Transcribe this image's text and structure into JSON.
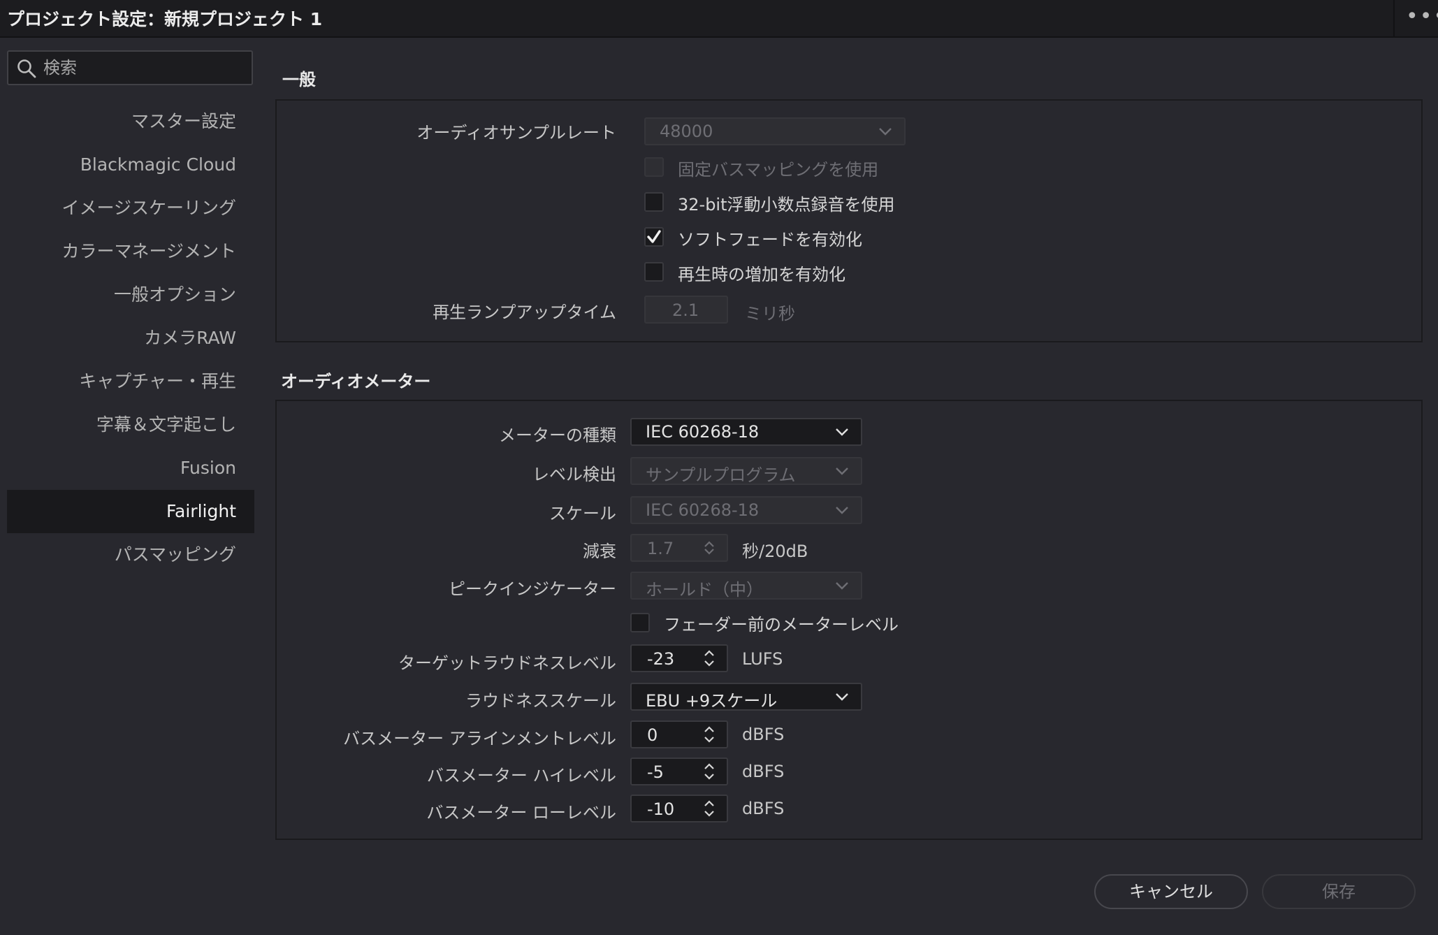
{
  "window": {
    "title": "プロジェクト設定：新規プロジェクト 1",
    "more": "•••"
  },
  "search": {
    "placeholder": "検索"
  },
  "sidebar": {
    "items": [
      {
        "label": "マスター設定"
      },
      {
        "label": "Blackmagic Cloud"
      },
      {
        "label": "イメージスケーリング"
      },
      {
        "label": "カラーマネージメント"
      },
      {
        "label": "一般オプション"
      },
      {
        "label": "カメラRAW"
      },
      {
        "label": "キャプチャー・再生"
      },
      {
        "label": "字幕＆文字起こし"
      },
      {
        "label": "Fusion"
      },
      {
        "label": "Fairlight"
      },
      {
        "label": "パスマッピング"
      }
    ],
    "active": "Fairlight"
  },
  "general": {
    "title": "一般",
    "sample_rate_label": "オーディオサンプルレート",
    "sample_rate_value": "48000",
    "fixed_bus_label": "固定バスマッピングを使用",
    "float32_label": "32-bit浮動小数点録音を使用",
    "softfade_label": "ソフトフェードを有効化",
    "softfade_checked": true,
    "playback_gain_label": "再生時の増加を有効化",
    "ramp_label": "再生ランプアップタイム",
    "ramp_value": "2.1",
    "ramp_unit": "ミリ秒"
  },
  "meters": {
    "title": "オーディオメーター",
    "type_label": "メーターの種類",
    "type_value": "IEC 60268-18",
    "level_detect_label": "レベル検出",
    "level_detect_value": "サンプルプログラム",
    "scale_label": "スケール",
    "scale_value": "IEC 60268-18",
    "decay_label": "減衰",
    "decay_value": "1.7",
    "decay_unit": "秒/20dB",
    "peak_label": "ピークインジケーター",
    "peak_value": "ホールド（中）",
    "prefader_label": "フェーダー前のメーターレベル",
    "target_label": "ターゲットラウドネスレベル",
    "target_value": "-23",
    "target_unit": "LUFS",
    "loud_scale_label": "ラウドネススケール",
    "loud_scale_value": "EBU +9スケール",
    "align_label": "バスメーター アラインメントレベル",
    "align_value": "0",
    "align_unit": "dBFS",
    "high_label": "バスメーター ハイレベル",
    "high_value": "-5",
    "high_unit": "dBFS",
    "low_label": "バスメーター ローレベル",
    "low_value": "-10",
    "low_unit": "dBFS"
  },
  "footer": {
    "cancel": "キャンセル",
    "save": "保存"
  }
}
